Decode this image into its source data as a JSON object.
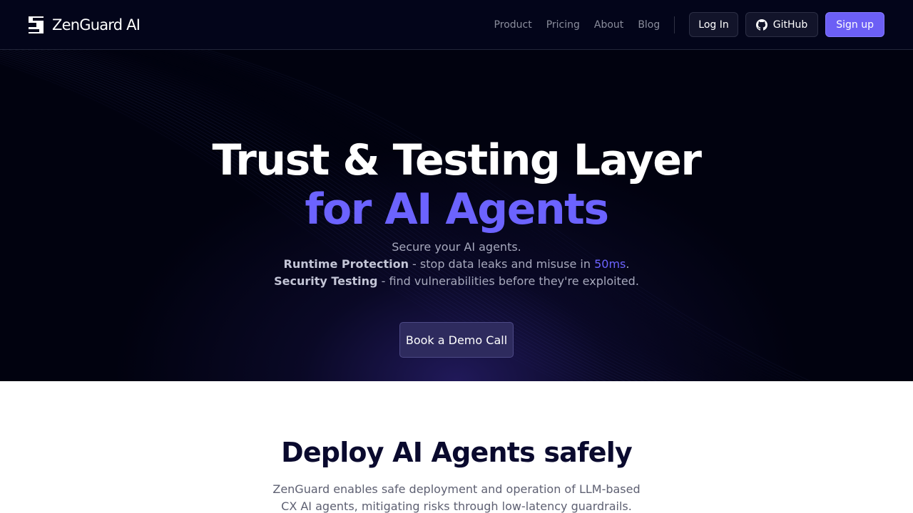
{
  "brand": {
    "name": "ZenGuard AI"
  },
  "nav": {
    "links": [
      "Product",
      "Pricing",
      "About",
      "Blog"
    ],
    "login_label": "Log In",
    "github_label": "GitHub",
    "signup_label": "Sign up"
  },
  "hero": {
    "title": "Trust & Testing Layer",
    "title_accent": "for AI Agents",
    "sub_line1": "Secure your AI agents.",
    "sub_line2_bold": "Runtime Protection",
    "sub_line2_text": " - stop data leaks and misuse in ",
    "sub_line2_accent": "50ms",
    "sub_line2_end": ".",
    "sub_line3_bold": "Security Testing",
    "sub_line3_text": " - find vulnerabilities before they're exploited.",
    "cta_label": "Book a Demo Call"
  },
  "section": {
    "title": "Deploy AI Agents safely",
    "description": "ZenGuard enables safe deployment and operation of LLM-based CX AI agents, mitigating risks through low-latency guardrails."
  },
  "colors": {
    "nav_bg": "#03051a",
    "hero_bg": "#01020f",
    "accent": "#6c63ff",
    "signup_bg": "#6c5ff5",
    "cta_bg": "#2e2b5e",
    "section_title": "#0a0a2e"
  },
  "icons": {
    "logo": "zenguard-logo-icon",
    "github": "github-icon"
  }
}
